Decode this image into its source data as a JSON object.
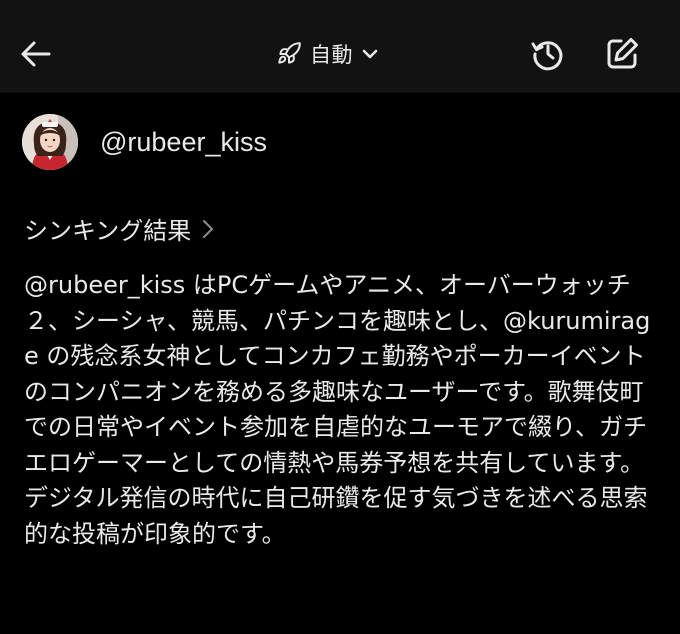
{
  "header": {
    "back_icon": "arrow-left-icon",
    "mode_icon": "rocket-icon",
    "mode_label": "自動",
    "mode_chevron_icon": "chevron-down-icon",
    "history_icon": "history-icon",
    "compose_icon": "compose-icon"
  },
  "user": {
    "avatar_icon": "user-avatar",
    "handle": "@rubeer_kiss"
  },
  "thinking": {
    "label": "シンキング結果",
    "chevron_icon": "chevron-right-icon"
  },
  "summary": {
    "text": "@rubeer_kiss はPCゲームやアニメ、オーバーウォッチ２、シーシャ、競馬、パチンコを趣味とし、@kurumirage の残念系女神としてコンカフェ勤務やポーカーイベントのコンパニオンを務める多趣味なユーザーです。歌舞伎町での日常やイベント参加を自虐的なユーモアで綴り、ガチエロゲーマーとしての情熱や馬券予想を共有しています。デジタル発信の時代に自己研鑽を促す気づきを述べる思索的な投稿が印象的です。"
  },
  "colors": {
    "background": "#000000",
    "header_background": "#121212",
    "text": "#e7e9ea",
    "muted": "#8b8b8b"
  }
}
